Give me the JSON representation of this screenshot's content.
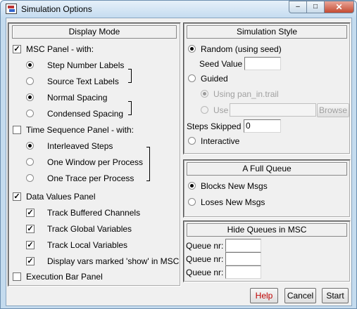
{
  "window": {
    "title": "Simulation Options",
    "controls": {
      "minimize": "–",
      "maximize": "□",
      "close": "✕"
    }
  },
  "display_mode": {
    "title": "Display Mode",
    "msc_panel": {
      "label": "MSC Panel - with:",
      "checked": true
    },
    "step_number_labels": "Step Number Labels",
    "source_text_labels": "Source Text Labels",
    "normal_spacing": "Normal Spacing",
    "condensed_spacing": "Condensed Spacing",
    "time_sequence_panel": {
      "label": "Time Sequence Panel - with:",
      "checked": false
    },
    "interleaved_steps": "Interleaved Steps",
    "one_window_per_process": "One Window per Process",
    "one_trace_per_process": "One Trace per Process",
    "data_values_panel": {
      "label": "Data Values Panel",
      "checked": true
    },
    "track_buffered_channels": "Track Buffered Channels",
    "track_global_variables": "Track Global Variables",
    "track_local_variables": "Track Local Variables",
    "display_vars_marked_show": "Display vars marked 'show' in MSC",
    "execution_bar_panel": {
      "label": "Execution Bar Panel",
      "checked": false
    }
  },
  "simulation_style": {
    "title": "Simulation Style",
    "random_label": "Random (using seed)",
    "seed_value_label": "Seed Value",
    "seed_value": "",
    "guided_label": "Guided",
    "using_trail_label": "Using pan_in.trail",
    "use_label": "Use",
    "use_value": "",
    "browse_label": "Browse",
    "steps_skipped_label": "Steps Skipped",
    "steps_skipped_value": "0",
    "interactive_label": "Interactive"
  },
  "full_queue": {
    "title": "A Full Queue",
    "blocks_label": "Blocks New Msgs",
    "loses_label": "Loses New Msgs"
  },
  "hide_queues": {
    "title": "Hide Queues in MSC",
    "queue_label": "Queue nr:",
    "queue_values": [
      "",
      "",
      ""
    ]
  },
  "footer": {
    "help": "Help",
    "cancel": "Cancel",
    "start": "Start"
  }
}
